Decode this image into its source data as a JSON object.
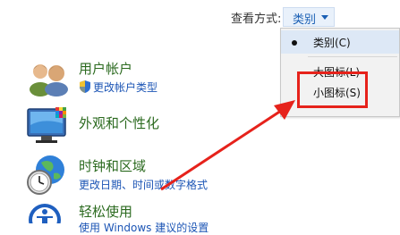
{
  "view_by": {
    "label": "查看方式:",
    "current": "类别"
  },
  "menu": {
    "items": [
      {
        "label": "类别(C)",
        "selected": true
      },
      {
        "label": "大图标(L)",
        "selected": false
      },
      {
        "label": "小图标(S)",
        "selected": false
      }
    ]
  },
  "categories": [
    {
      "title": "用户帐户",
      "links": [
        "更改帐户类型"
      ],
      "icon": "users-icon"
    },
    {
      "title": "外观和个性化",
      "links": [],
      "icon": "monitor-personalization-icon"
    },
    {
      "title": "时钟和区域",
      "links": [
        "更改日期、时间或数字格式"
      ],
      "icon": "clock-globe-icon"
    },
    {
      "title": "轻松使用",
      "links": [
        "使用 Windows 建议的设置"
      ],
      "icon": "ease-of-access-icon"
    }
  ],
  "colors": {
    "category_title": "#2b6a1f",
    "link": "#1c55b5",
    "annotation": "#e6221b"
  }
}
